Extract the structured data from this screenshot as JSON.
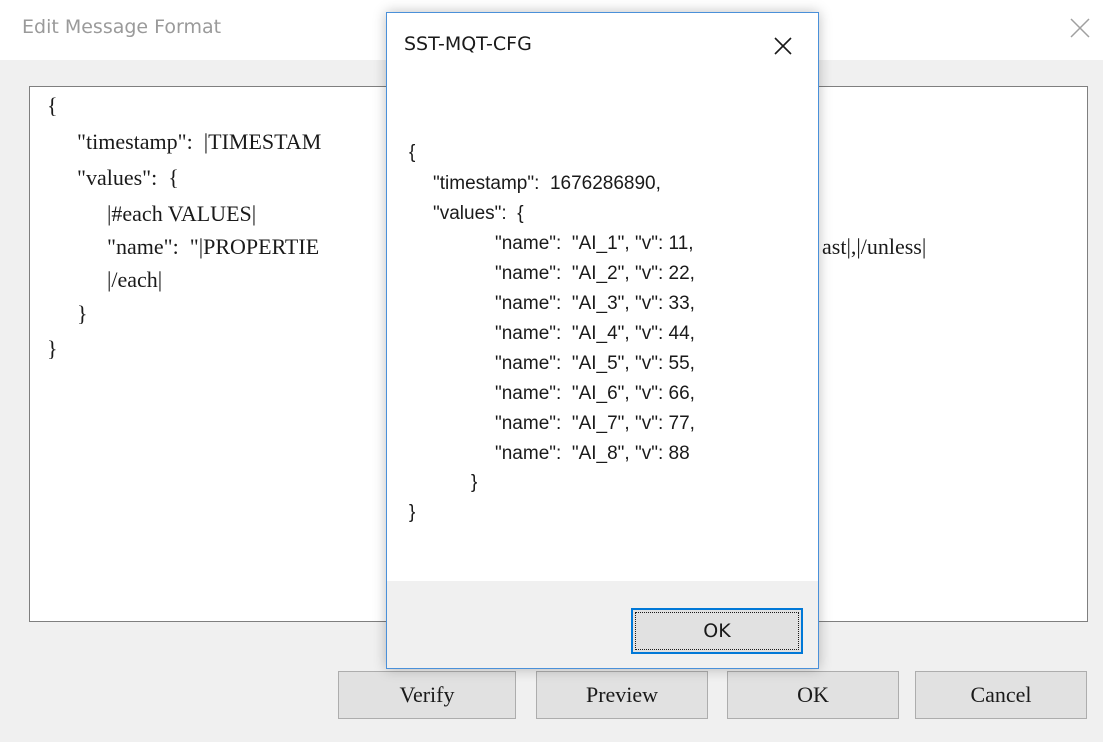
{
  "parent_dialog": {
    "title": "Edit Message Format",
    "close_glyph": "close-icon",
    "editor_lines": [
      "{",
      "\"timestamp\":  |TIMESTAM",
      "\"values\":  {",
      "|#each VALUES|",
      "\"name\":  \"|PROPERTIE",
      "|/each|",
      "}",
      "}"
    ],
    "editor_line_tail": "ast|,|/unless|",
    "buttons": {
      "verify": "Verify",
      "preview": "Preview",
      "ok": "OK",
      "cancel": "Cancel"
    }
  },
  "modal": {
    "title": "SST-MQT-CFG",
    "close_glyph": "close-icon",
    "message_lines": [
      "{",
      "\"timestamp\":  1676286890,",
      "\"values\":  {",
      "\"name\":  \"AI_1\", \"v\": 11,",
      "\"name\":  \"AI_2\", \"v\": 22,",
      "\"name\":  \"AI_3\", \"v\": 33,",
      "\"name\":  \"AI_4\", \"v\": 44,",
      "\"name\":  \"AI_5\", \"v\": 55,",
      "\"name\":  \"AI_6\", \"v\": 66,",
      "\"name\":  \"AI_7\", \"v\": 77,",
      "\"name\":  \"AI_8\", \"v\": 88",
      "}",
      "}"
    ],
    "ok_label": "OK"
  },
  "colors": {
    "dialog_bg": "#f0f0f0",
    "focus_border": "#0078d7",
    "modal_border": "#4a90d9"
  }
}
